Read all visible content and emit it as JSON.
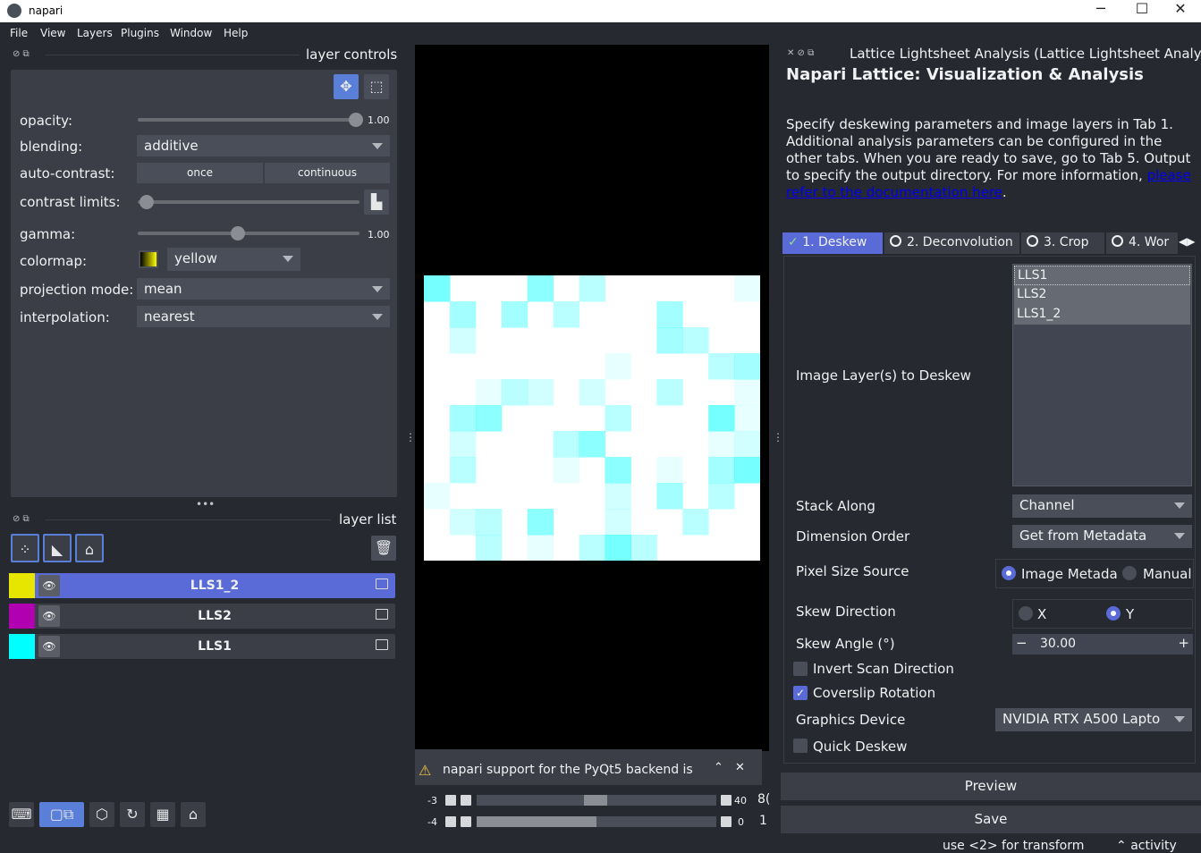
{
  "window": {
    "title": "napari",
    "minimize": "─",
    "maximize": "☐",
    "close": "✕"
  },
  "menu": [
    "File",
    "View",
    "Layers",
    "Plugins",
    "Window",
    "Help"
  ],
  "layer_controls": {
    "title": "layer controls",
    "opacity_label": "opacity:",
    "opacity_value": "1.00",
    "opacity_level": 1.0,
    "blending_label": "blending:",
    "blending_value": "additive",
    "autocontrast_label": "auto-contrast:",
    "once_label": "once",
    "continuous_label": "continuous",
    "contrast_label": "contrast limits:",
    "gamma_label": "gamma:",
    "gamma_value": "1.00",
    "gamma_level": 0.45,
    "colormap_label": "colormap:",
    "colormap_value": "yellow",
    "projection_label": "projection mode:",
    "projection_value": "mean",
    "interpolation_label": "interpolation:",
    "interpolation_value": "nearest"
  },
  "layer_list": {
    "title": "layer list",
    "layers": [
      {
        "name": "LLS1_2",
        "selected": true,
        "thumb_color": "#e6e600"
      },
      {
        "name": "LLS2",
        "selected": false,
        "thumb_color": "#b000b0"
      },
      {
        "name": "LLS1",
        "selected": false,
        "thumb_color": "#00ffff"
      }
    ]
  },
  "canvas": {
    "notification": "napari support for the PyQt5 backend is",
    "dim_sliders": [
      {
        "left": "-3",
        "right": "40",
        "extra": "8("
      },
      {
        "left": "-4",
        "right": "0",
        "extra": "1"
      }
    ]
  },
  "plugin": {
    "dock_title": "Lattice Lightsheet Analysis (Lattice Lightsheet Analysis)",
    "heading": "Napari Lattice: Visualization & Analysis",
    "description": "Specify deskewing parameters and image layers in Tab 1. Additional analysis parameters can be configured in the other tabs. When you are ready to save, go to Tab 5. Output to specify the output directory. For more information,",
    "link": "please refer to the documentation here",
    "tabs": [
      "1. Deskew",
      "2. Deconvolution",
      "3. Crop",
      "4. Wor"
    ],
    "image_layers_label": "Image Layer(s) to Deskew",
    "image_layers": [
      "LLS1",
      "LLS2",
      "LLS1_2"
    ],
    "stack_along_label": "Stack Along",
    "stack_along_value": "Channel",
    "dim_order_label": "Dimension Order",
    "dim_order_value": "Get from Metadata",
    "pixel_size_label": "Pixel Size Source",
    "pixel_opt1": "Image Metadat",
    "pixel_opt2": "Manual",
    "skew_dir_label": "Skew Direction",
    "skew_x": "X",
    "skew_y": "Y",
    "skew_angle_label": "Skew Angle (°)",
    "skew_angle_value": "30.00",
    "invert_label": "Invert Scan Direction",
    "coverslip_label": "Coverslip Rotation",
    "graphics_label": "Graphics Device",
    "graphics_value": "NVIDIA RTX A500 Lapto",
    "quick_label": "Quick Deskew",
    "preview_label": "Preview",
    "save_label": "Save"
  },
  "status": {
    "hint": "use <2> for transform",
    "activity": "activity"
  },
  "colors": {
    "accent": "#5a6ad6",
    "background": "#262930",
    "panel": "#3b3e47",
    "cyan": "#00ffff"
  }
}
